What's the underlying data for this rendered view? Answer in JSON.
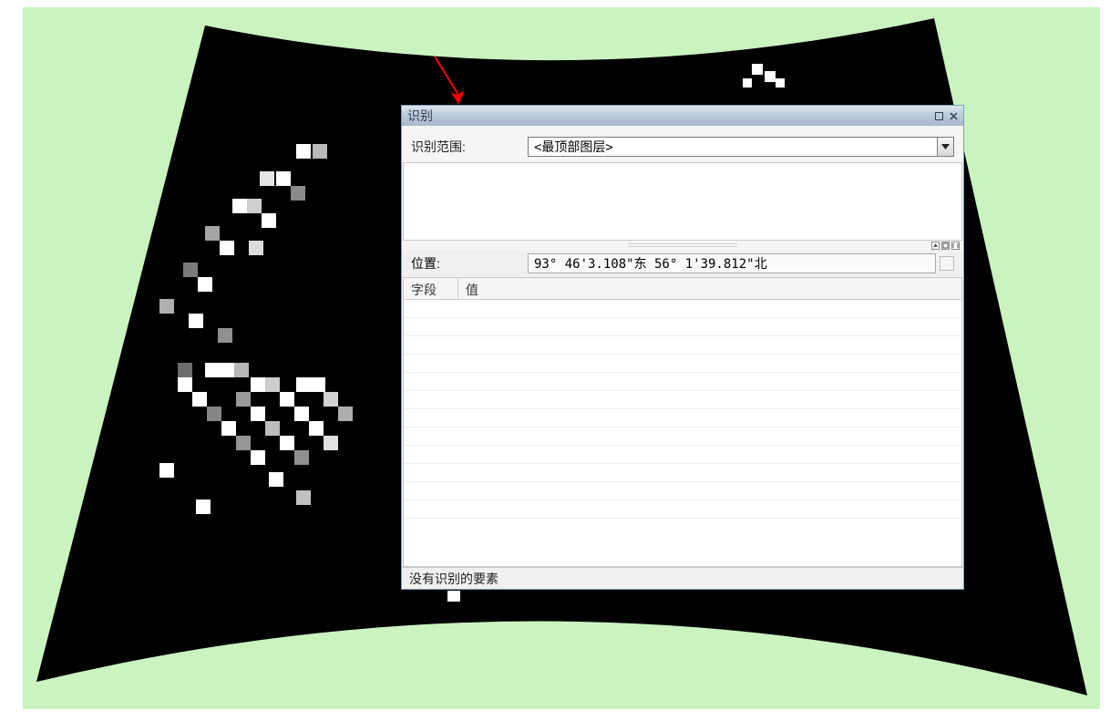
{
  "dialog": {
    "title": "识别",
    "identify_from_label": "识别范围:",
    "identify_from_value": "<最顶部图层>",
    "location_label": "位置:",
    "location_value": "93° 46'3.108\"东  56° 1'39.812\"北",
    "grid": {
      "field_header": "字段",
      "value_header": "值"
    },
    "status": "没有识别的要素"
  },
  "arrow": {
    "color": "#ff0000"
  },
  "background": {
    "fill": "#caf3c0"
  }
}
